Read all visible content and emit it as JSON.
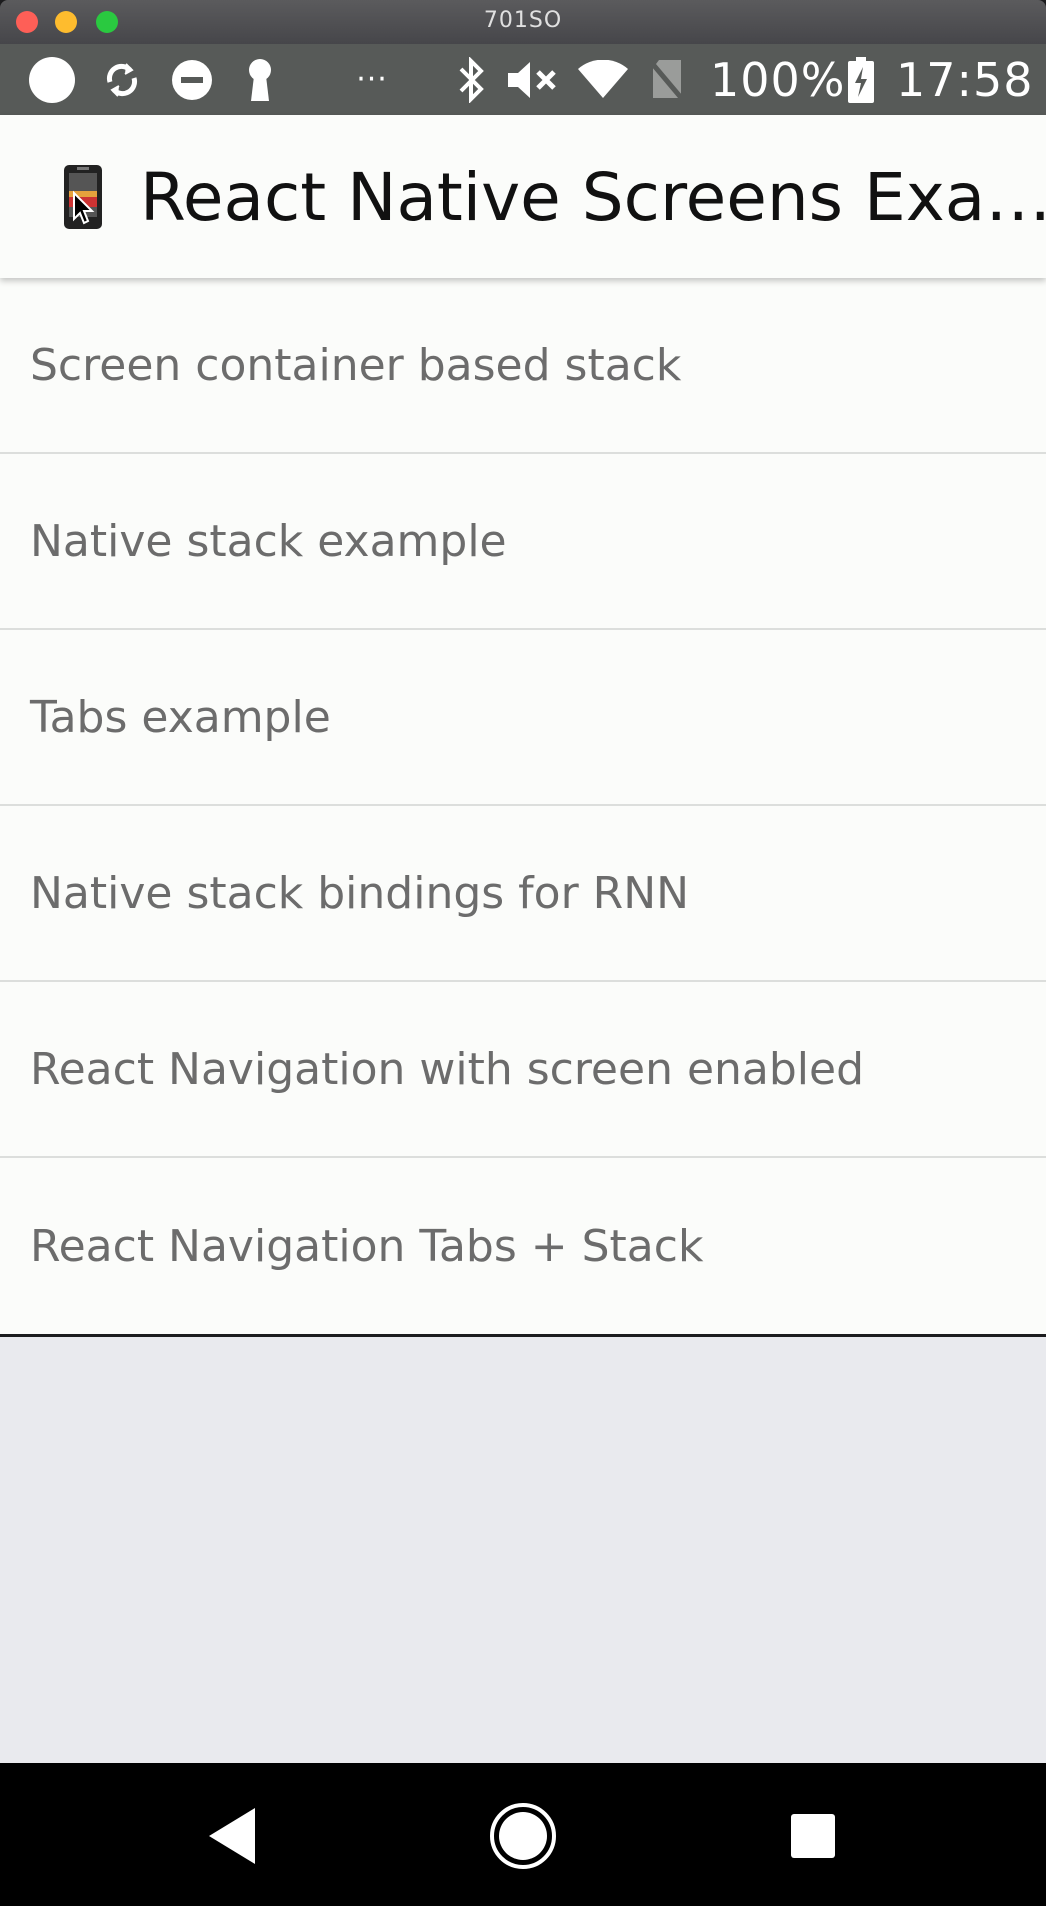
{
  "window": {
    "title": "701SO"
  },
  "status_bar": {
    "more_indicator": "···",
    "battery": "100%",
    "time": "17:58",
    "icons": [
      "circle-icon",
      "sync-icon",
      "do-not-disturb-icon",
      "keyhole-icon",
      "bluetooth-icon",
      "mute-icon",
      "wifi-icon",
      "no-sim-icon",
      "battery-charging-icon"
    ]
  },
  "app_bar": {
    "title": "React Native Screens Exa…",
    "icon": "phone-icon"
  },
  "list": {
    "items": [
      {
        "label": "Screen container based stack"
      },
      {
        "label": "Native stack example"
      },
      {
        "label": "Tabs example"
      },
      {
        "label": "Native stack bindings for RNN"
      },
      {
        "label": "React Navigation with screen enabled"
      },
      {
        "label": "React Navigation Tabs + Stack"
      }
    ]
  },
  "nav_bar": {
    "buttons": [
      "back-icon",
      "home-icon",
      "recents-icon"
    ]
  },
  "colors": {
    "app_bg": "#fbfcfa",
    "status_bar": "#575a58",
    "empty_area": "#e9eaee",
    "item_text": "#6c6c6c"
  }
}
